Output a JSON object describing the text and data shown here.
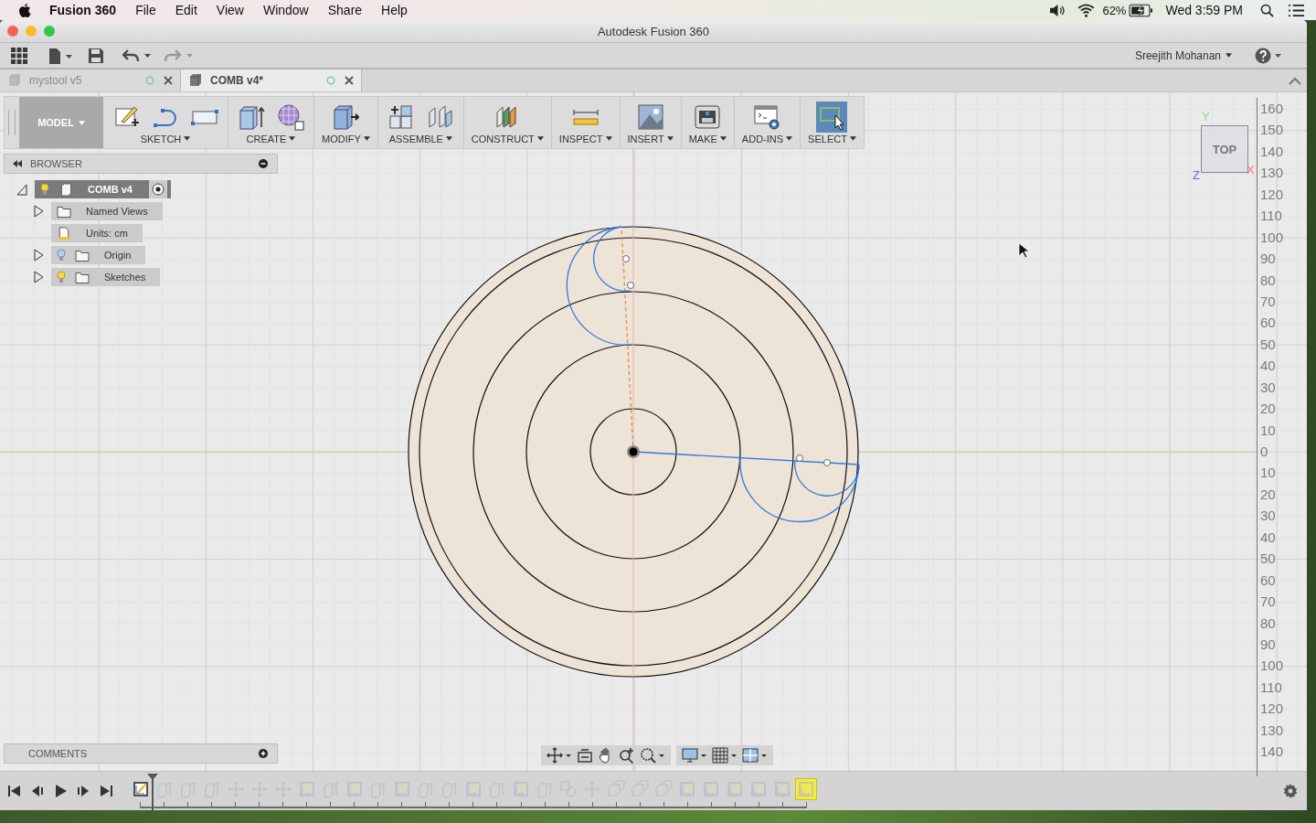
{
  "menu_bar": {
    "app_name": "Fusion 360",
    "menus": [
      "File",
      "Edit",
      "View",
      "Window",
      "Share",
      "Help"
    ],
    "battery": "62%",
    "clock": "Wed 3:59 PM"
  },
  "window": {
    "title": "Autodesk Fusion 360"
  },
  "toolbar": {
    "user": "Sreejith Mohanan"
  },
  "tabs": [
    {
      "label": "mystool v5",
      "selected": false
    },
    {
      "label": "COMB v4*",
      "selected": true
    }
  ],
  "ribbon": {
    "workspace": "MODEL",
    "groups": [
      {
        "label": "SKETCH",
        "kind": "sketch",
        "selected": false
      },
      {
        "label": "CREATE",
        "kind": "create",
        "selected": false
      },
      {
        "label": "MODIFY",
        "kind": "modify",
        "selected": false
      },
      {
        "label": "ASSEMBLE",
        "kind": "assemble",
        "selected": false
      },
      {
        "label": "CONSTRUCT",
        "kind": "construct",
        "selected": false
      },
      {
        "label": "INSPECT",
        "kind": "inspect",
        "selected": false
      },
      {
        "label": "INSERT",
        "kind": "insert",
        "selected": false
      },
      {
        "label": "MAKE",
        "kind": "make",
        "selected": false
      },
      {
        "label": "ADD-INS",
        "kind": "addins",
        "selected": false
      },
      {
        "label": "SELECT",
        "kind": "select",
        "selected": true
      }
    ]
  },
  "browser": {
    "title": "BROWSER",
    "tree": [
      {
        "label": "COMB v4",
        "kind": "component",
        "visible": true,
        "expanded": true,
        "children": [
          {
            "label": "Named Views",
            "kind": "folder",
            "expanded": false
          },
          {
            "label": "Units: cm",
            "kind": "units"
          },
          {
            "label": "Origin",
            "kind": "folder",
            "visible": false,
            "expanded": false
          },
          {
            "label": "Sketches",
            "kind": "folder",
            "visible": true,
            "expanded": false
          }
        ]
      }
    ]
  },
  "view_cube": {
    "face": "TOP",
    "axis_y": "Y",
    "axis_z": "Z",
    "axis_x": "X"
  },
  "ruler": {
    "labels": [
      "160",
      "150",
      "140",
      "130",
      "120",
      "110",
      "100",
      "90",
      "80",
      "70",
      "60",
      "50",
      "40",
      "30",
      "20",
      "10",
      "0",
      "10",
      "20",
      "30",
      "40",
      "50",
      "60",
      "70",
      "80",
      "90",
      "100",
      "110",
      "120",
      "130",
      "140"
    ]
  },
  "comments": {
    "title": "COMMENTS"
  },
  "timeline": {
    "steps": [
      {
        "kind": "sketch",
        "rolled_back": false,
        "selected": false
      },
      {
        "kind": "extrude",
        "rolled_back": true,
        "selected": false
      },
      {
        "kind": "extrude",
        "rolled_back": true,
        "selected": false
      },
      {
        "kind": "extrude",
        "rolled_back": true,
        "selected": false
      },
      {
        "kind": "move",
        "rolled_back": true,
        "selected": false
      },
      {
        "kind": "move",
        "rolled_back": true,
        "selected": false
      },
      {
        "kind": "move",
        "rolled_back": true,
        "selected": false
      },
      {
        "kind": "sketch",
        "rolled_back": true,
        "selected": false
      },
      {
        "kind": "extrude",
        "rolled_back": true,
        "selected": false
      },
      {
        "kind": "sketch",
        "rolled_back": true,
        "selected": false
      },
      {
        "kind": "extrude",
        "rolled_back": true,
        "selected": false
      },
      {
        "kind": "sketch",
        "rolled_back": true,
        "selected": false
      },
      {
        "kind": "extrude",
        "rolled_back": true,
        "selected": false
      },
      {
        "kind": "extrude",
        "rolled_back": true,
        "selected": false
      },
      {
        "kind": "sketch",
        "rolled_back": true,
        "selected": false
      },
      {
        "kind": "extrude",
        "rolled_back": true,
        "selected": false
      },
      {
        "kind": "sketch",
        "rolled_back": true,
        "selected": false
      },
      {
        "kind": "extrude",
        "rolled_back": true,
        "selected": false
      },
      {
        "kind": "combine",
        "rolled_back": true,
        "selected": false
      },
      {
        "kind": "move",
        "rolled_back": true,
        "selected": false
      },
      {
        "kind": "copy",
        "rolled_back": true,
        "selected": false
      },
      {
        "kind": "copy",
        "rolled_back": true,
        "selected": false
      },
      {
        "kind": "copy",
        "rolled_back": true,
        "selected": false
      },
      {
        "kind": "sketch",
        "rolled_back": true,
        "selected": false
      },
      {
        "kind": "sketch",
        "rolled_back": true,
        "selected": false
      },
      {
        "kind": "sketch",
        "rolled_back": true,
        "selected": false
      },
      {
        "kind": "sketch",
        "rolled_back": true,
        "selected": false
      },
      {
        "kind": "sketch",
        "rolled_back": true,
        "selected": false
      },
      {
        "kind": "sketch",
        "rolled_back": true,
        "selected": true
      }
    ]
  }
}
